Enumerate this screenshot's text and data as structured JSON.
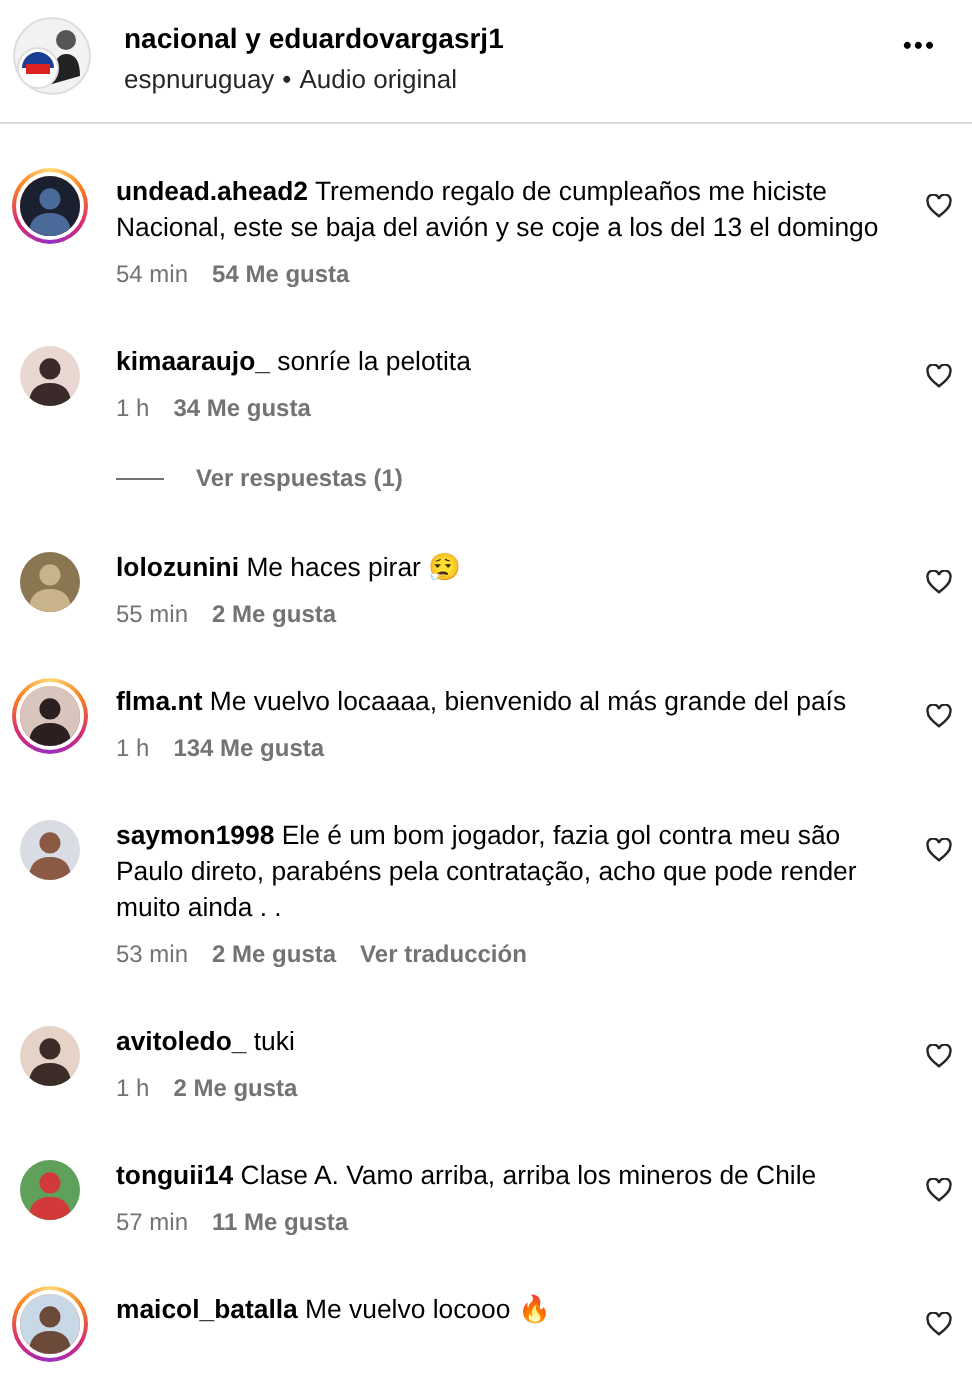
{
  "post": {
    "title": "nacional y eduardovargasrj1",
    "author": "espnuruguay",
    "separator": "•",
    "audio": "Audio original",
    "menu": "•••"
  },
  "comments": [
    {
      "user": "undead.ahead2",
      "text": "Tremendo regalo de cumpleaños me hiciste Nacional, este se baja del avión y se coje a los del 13 el domingo",
      "time": "54 min",
      "likes": "54 Me gusta",
      "story": true
    },
    {
      "user": "kimaaraujo_",
      "text": "sonríe la pelotita",
      "time": "1 h",
      "likes": "34 Me gusta",
      "story": false,
      "replies": "Ver respuestas (1)"
    },
    {
      "user": "lolozunini",
      "text": "Me haces pirar 😮‍💨",
      "time": "55 min",
      "likes": "2 Me gusta",
      "story": false
    },
    {
      "user": "flma.nt",
      "text": "Me vuelvo locaaaa, bienvenido al más grande del país",
      "time": "1 h",
      "likes": "134 Me gusta",
      "story": true
    },
    {
      "user": "saymon1998",
      "text": "Ele é um bom jogador, fazia gol contra meu são Paulo direto, parabéns pela contratação, acho que pode render muito ainda . .",
      "time": "53 min",
      "likes": "2 Me gusta",
      "story": false,
      "translate": "Ver traducción"
    },
    {
      "user": "avitoledo_",
      "text": "tuki",
      "time": "1 h",
      "likes": "2 Me gusta",
      "story": false
    },
    {
      "user": "tonguii14",
      "text": "Clase A. Vamo arriba, arriba los mineros de Chile",
      "time": "57 min",
      "likes": "11 Me gusta",
      "story": false
    },
    {
      "user": "maicol_batalla",
      "text": "Me vuelvo locooo 🔥",
      "story": true
    }
  ]
}
